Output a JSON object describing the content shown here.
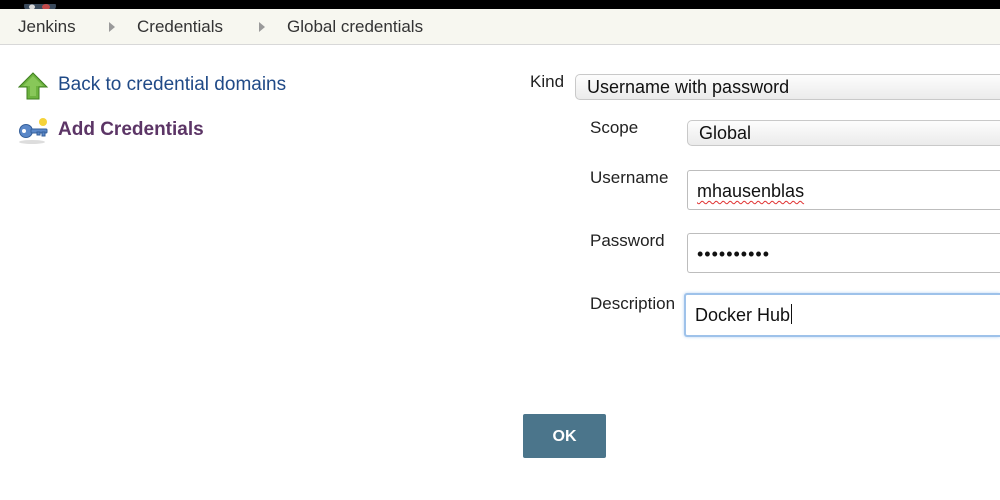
{
  "breadcrumbs": [
    "Jenkins",
    "Credentials",
    "Global credentials"
  ],
  "side_panel": {
    "back_label": "Back to credential domains",
    "add_label": "Add Credentials"
  },
  "form": {
    "kind": {
      "label": "Kind",
      "value": "Username with password"
    },
    "scope": {
      "label": "Scope",
      "value": "Global"
    },
    "username": {
      "label": "Username",
      "value": "mhausenblas"
    },
    "password": {
      "label": "Password",
      "value": "••••••••••"
    },
    "description": {
      "label": "Description",
      "value": "Docker Hub"
    },
    "ok_label": "OK"
  },
  "colors": {
    "link": "#204a87",
    "task_active": "#5c3566",
    "ok_button": "#4b758b",
    "breadcrumb_bg": "#f7f7f0"
  }
}
